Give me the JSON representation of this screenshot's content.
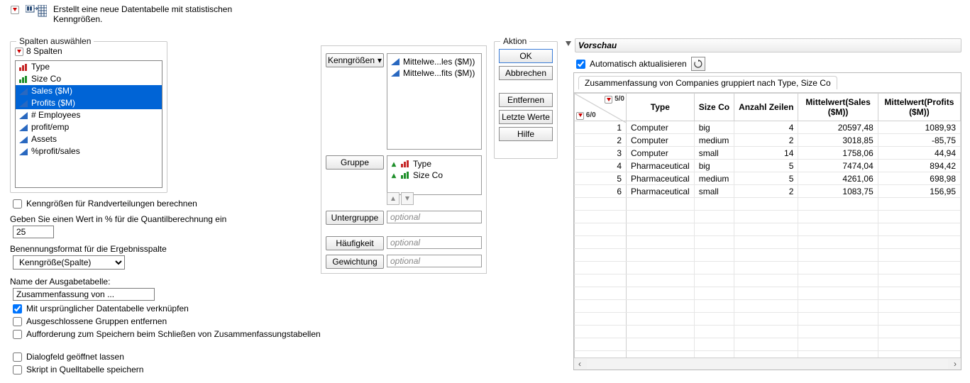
{
  "description": "Erstellt eine neue Datentabelle mit statistischen\nKenngrößen.",
  "columns_group_title": "Spalten auswählen",
  "columns_header": "8 Spalten",
  "columns": [
    {
      "label": "Type",
      "icon": "bars-red",
      "selected": false
    },
    {
      "label": "Size Co",
      "icon": "bars-green",
      "selected": false
    },
    {
      "label": "Sales ($M)",
      "icon": "tri",
      "selected": true
    },
    {
      "label": "Profits ($M)",
      "icon": "tri",
      "selected": true
    },
    {
      "label": "# Employees",
      "icon": "tri",
      "selected": false
    },
    {
      "label": "profit/emp",
      "icon": "tri",
      "selected": false
    },
    {
      "label": "Assets",
      "icon": "tri",
      "selected": false
    },
    {
      "label": "%profit/sales",
      "icon": "tri",
      "selected": false
    }
  ],
  "checkbox_marginal": "Kenngrößen für Randverteilungen berechnen",
  "quantile_line": "Geben Sie einen Wert in % für die Quantilberechnung ein",
  "quantile_value": "25",
  "naming_line": "Benennungsformat für die Ergebnisspalte",
  "naming_select": "Kenngröße(Spalte)",
  "output_name_line": "Name der Ausgabetabelle:",
  "output_name_value": "Zusammenfassung von ...",
  "cb_link": "Mit ursprünglicher Datentabelle verknüpfen",
  "cb_excluded": "Ausgeschlossene Gruppen entfernen",
  "cb_save_prompt": "Aufforderung zum Speichern beim Schließen von Zusammenfassungstabellen",
  "cb_keep_dialog": "Dialogfeld geöffnet lassen",
  "cb_save_script": "Skript in Quelltabelle speichern",
  "role_buttons": {
    "stat": "Kenngrößen",
    "group": "Gruppe",
    "subgroup": "Untergruppe",
    "freq": "Häufigkeit",
    "weight": "Gewichtung"
  },
  "role_values": {
    "stat": [
      "Mittelwe...les ($M))",
      "Mittelwe...fits ($M))"
    ],
    "group": [
      "Type",
      "Size Co"
    ],
    "subgroup_ph": "optional",
    "freq_ph": "optional",
    "weight_ph": "optional"
  },
  "actions_title": "Aktion",
  "actions": {
    "ok": "OK",
    "cancel": "Abbrechen",
    "remove": "Entfernen",
    "recall": "Letzte Werte",
    "help": "Hilfe"
  },
  "preview_title": "Vorschau",
  "auto_refresh": "Automatisch aktualisieren",
  "grid_caption": "Zusammenfassung von Companies gruppiert nach Type, Size Co",
  "corner_top": "5/0",
  "corner_bottom": "6/0",
  "grid_headers": [
    "Type",
    "Size Co",
    "Anzahl Zeilen",
    "Mittelwert(Sales ($M))",
    "Mittelwert(Profits ($M))"
  ],
  "grid_rows": [
    {
      "n": 1,
      "type": "Computer",
      "size": "big",
      "count": "4",
      "sales": "20597,48",
      "profits": "1089,93"
    },
    {
      "n": 2,
      "type": "Computer",
      "size": "medium",
      "count": "2",
      "sales": "3018,85",
      "profits": "-85,75"
    },
    {
      "n": 3,
      "type": "Computer",
      "size": "small",
      "count": "14",
      "sales": "1758,06",
      "profits": "44,94"
    },
    {
      "n": 4,
      "type": "Pharmaceutical",
      "size": "big",
      "count": "5",
      "sales": "7474,04",
      "profits": "894,42"
    },
    {
      "n": 5,
      "type": "Pharmaceutical",
      "size": "medium",
      "count": "5",
      "sales": "4261,06",
      "profits": "698,98"
    },
    {
      "n": 6,
      "type": "Pharmaceutical",
      "size": "small",
      "count": "2",
      "sales": "1083,75",
      "profits": "156,95"
    }
  ]
}
